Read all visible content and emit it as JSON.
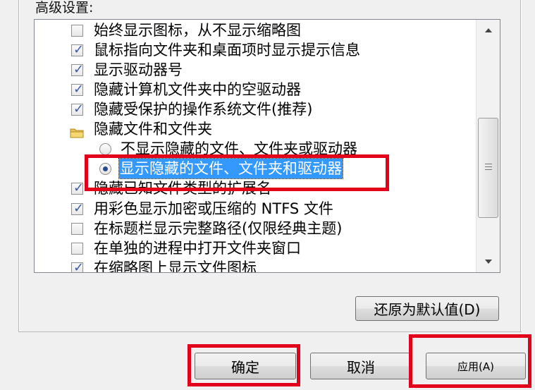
{
  "group": {
    "label": "高级设置:"
  },
  "list_items": [
    {
      "type": "checkbox",
      "checked": false,
      "label": "始终显示图标，从不显示缩略图"
    },
    {
      "type": "checkbox",
      "checked": true,
      "label": "鼠标指向文件夹和桌面项时显示提示信息"
    },
    {
      "type": "checkbox",
      "checked": true,
      "label": "显示驱动器号"
    },
    {
      "type": "checkbox",
      "checked": true,
      "label": "隐藏计算机文件夹中的空驱动器"
    },
    {
      "type": "checkbox",
      "checked": true,
      "label": "隐藏受保护的操作系统文件(推荐)"
    },
    {
      "type": "folder",
      "label": "隐藏文件和文件夹",
      "icon": "folder-icon"
    },
    {
      "type": "radio",
      "checked": false,
      "label": "不显示隐藏的文件、文件夹或驱动器"
    },
    {
      "type": "radio",
      "checked": true,
      "selected": true,
      "label": "显示隐藏的文件、文件夹和驱动器"
    },
    {
      "type": "checkbox",
      "checked": true,
      "label": "隐藏已知文件类型的扩展名"
    },
    {
      "type": "checkbox",
      "checked": true,
      "label": "用彩色显示加密或压缩的 NTFS 文件"
    },
    {
      "type": "checkbox",
      "checked": false,
      "label": "在标题栏显示完整路径(仅限经典主题)"
    },
    {
      "type": "checkbox",
      "checked": false,
      "label": "在单独的进程中打开文件夹窗口"
    },
    {
      "type": "checkbox",
      "checked": true,
      "label": "在缩略图上显示文件图标"
    }
  ],
  "buttons": {
    "restore_defaults": "还原为默认值(D)",
    "ok": "确定",
    "cancel": "取消",
    "apply": "应用(A)"
  },
  "colors": {
    "highlight": "#e3001a",
    "selection": "#3399ff",
    "checkmark": "#3b5aa6"
  }
}
